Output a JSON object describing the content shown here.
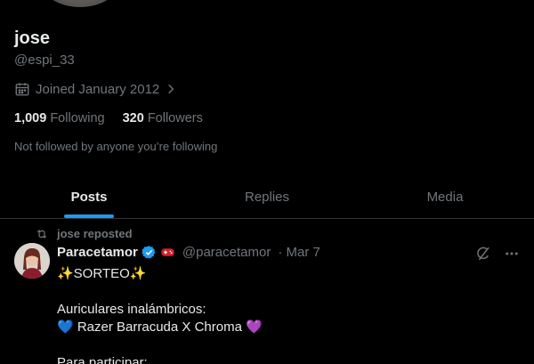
{
  "profile": {
    "name": "jose",
    "handle": "@espi_33",
    "joined": "Joined January 2012",
    "following_count": "1,009",
    "following_label": "Following",
    "followers_count": "320",
    "followers_label": "Followers",
    "followed_by": "Not followed by anyone you’re following"
  },
  "tabs": [
    {
      "label": "Posts",
      "active": true
    },
    {
      "label": "Replies",
      "active": false
    },
    {
      "label": "Media",
      "active": false
    }
  ],
  "post": {
    "repost_label": "jose reposted",
    "author_name": "Paracetamor",
    "author_handle": "@paracetamor",
    "date": "· Mar 7",
    "lines": [
      "✨SORTEO✨",
      "",
      "Auriculares inalámbricos:",
      "💙 Razer Barracuda X Chroma 💜",
      "",
      "Para participar:"
    ]
  },
  "colors": {
    "accent": "#1d9bf0",
    "muted": "#71767b",
    "text": "#e7e9ea",
    "background": "#000000",
    "divider": "#2f3336"
  },
  "icons": [
    "calendar-icon",
    "chevron-right-icon",
    "repost-icon",
    "verified-badge-icon",
    "gamepad-icon",
    "grok-icon",
    "more-icon"
  ]
}
